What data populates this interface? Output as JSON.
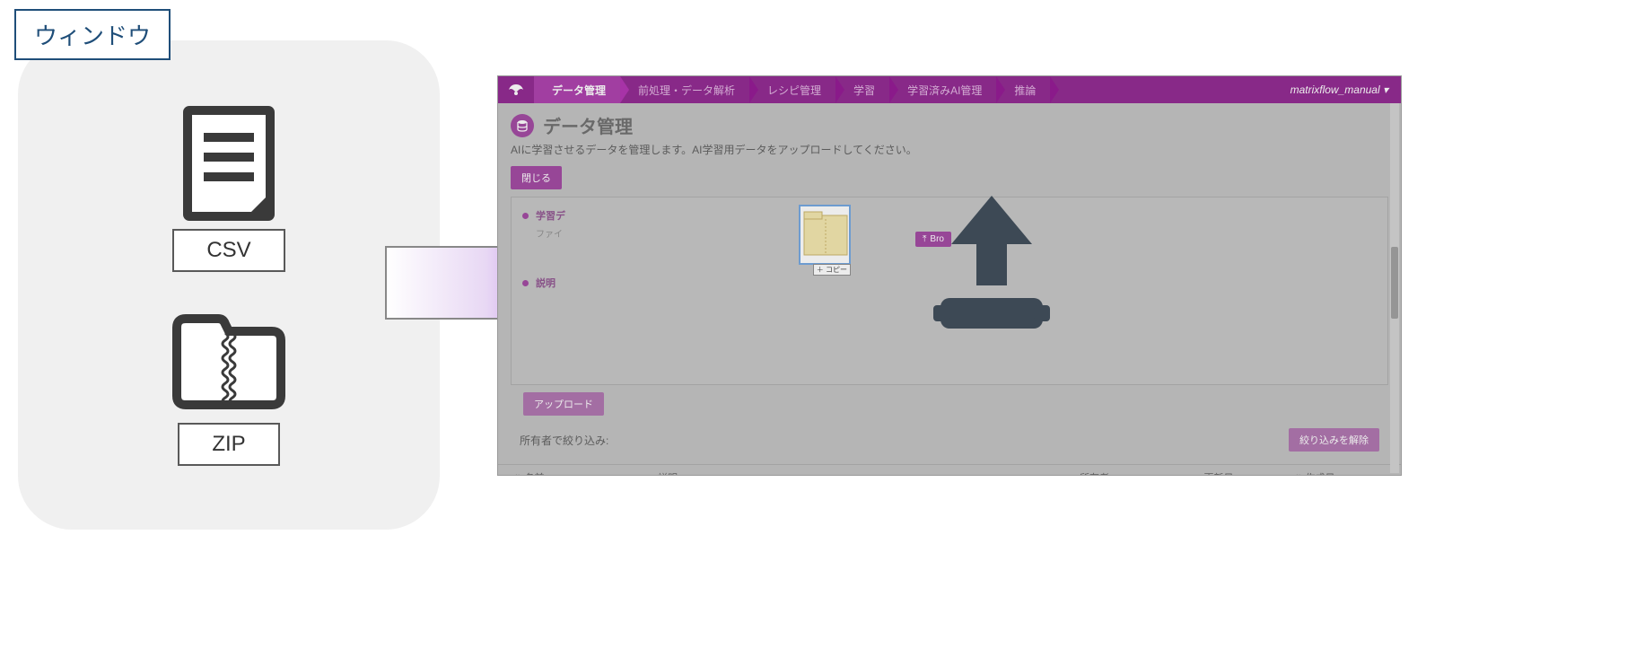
{
  "window_label": "ウィンドウ",
  "file_types": {
    "csv": "CSV",
    "zip": "ZIP"
  },
  "topbar": {
    "items": [
      "データ管理",
      "前処理・データ解析",
      "レシピ管理",
      "学習",
      "学習済みAI管理",
      "推論"
    ],
    "active_index": 0,
    "user": "matrixflow_manual"
  },
  "page": {
    "title": "データ管理",
    "subtitle": "AIに学習させるデータを管理します。AI学習用データをアップロードしてください。"
  },
  "buttons": {
    "close": "閉じる",
    "browse": "Bro",
    "upload": "アップロード",
    "clear_filter": "絞り込みを解除"
  },
  "upload_form": {
    "field1_label": "学習デ",
    "field1_sub": "ファイ",
    "field2_label": "説明",
    "drag_copy_tag": "＋ コピー"
  },
  "filter": {
    "label": "所有者で絞り込み:"
  },
  "table": {
    "cols": {
      "name": "名前",
      "desc": "説明",
      "owner": "所有者",
      "updated": "更新日",
      "created": "作成日"
    }
  }
}
